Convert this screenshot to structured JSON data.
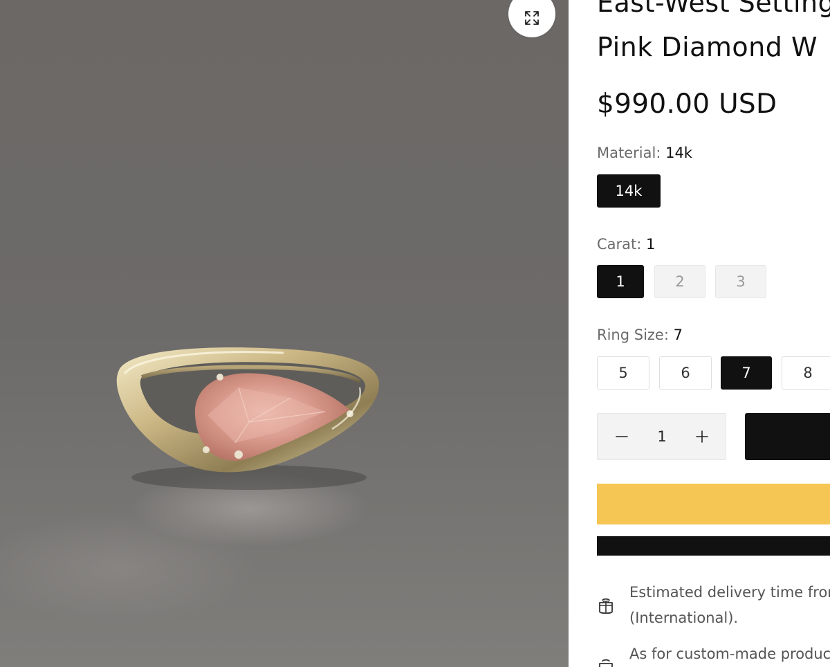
{
  "product": {
    "title_line1": "East-West Setting",
    "title_line2": "Pink Diamond W",
    "price": "$990.00 USD"
  },
  "gallery": {
    "zoom_icon": "expand-icon"
  },
  "options": {
    "material": {
      "label": "Material:",
      "selected": "14k",
      "values": [
        "14k"
      ]
    },
    "carat": {
      "label": "Carat:",
      "selected": "1",
      "values": [
        "1",
        "2",
        "3"
      ]
    },
    "ring_size": {
      "label": "Ring Size:",
      "selected": "7",
      "values": [
        "5",
        "6",
        "7",
        "8"
      ]
    }
  },
  "quantity": {
    "value": "1",
    "minus_icon": "minus-icon",
    "plus_icon": "plus-icon"
  },
  "colors": {
    "primary": "#111111",
    "accent_yellow": "#f5c653",
    "swatch_unavailable": "#f3f3f3",
    "label_gray": "#6b6b6b"
  },
  "notes": [
    {
      "icon": "shipping-box-icon",
      "line1": "Estimated delivery time from",
      "line2": "(International)."
    },
    {
      "icon": "shipping-box-icon",
      "line1": "As for custom-made products"
    }
  ]
}
